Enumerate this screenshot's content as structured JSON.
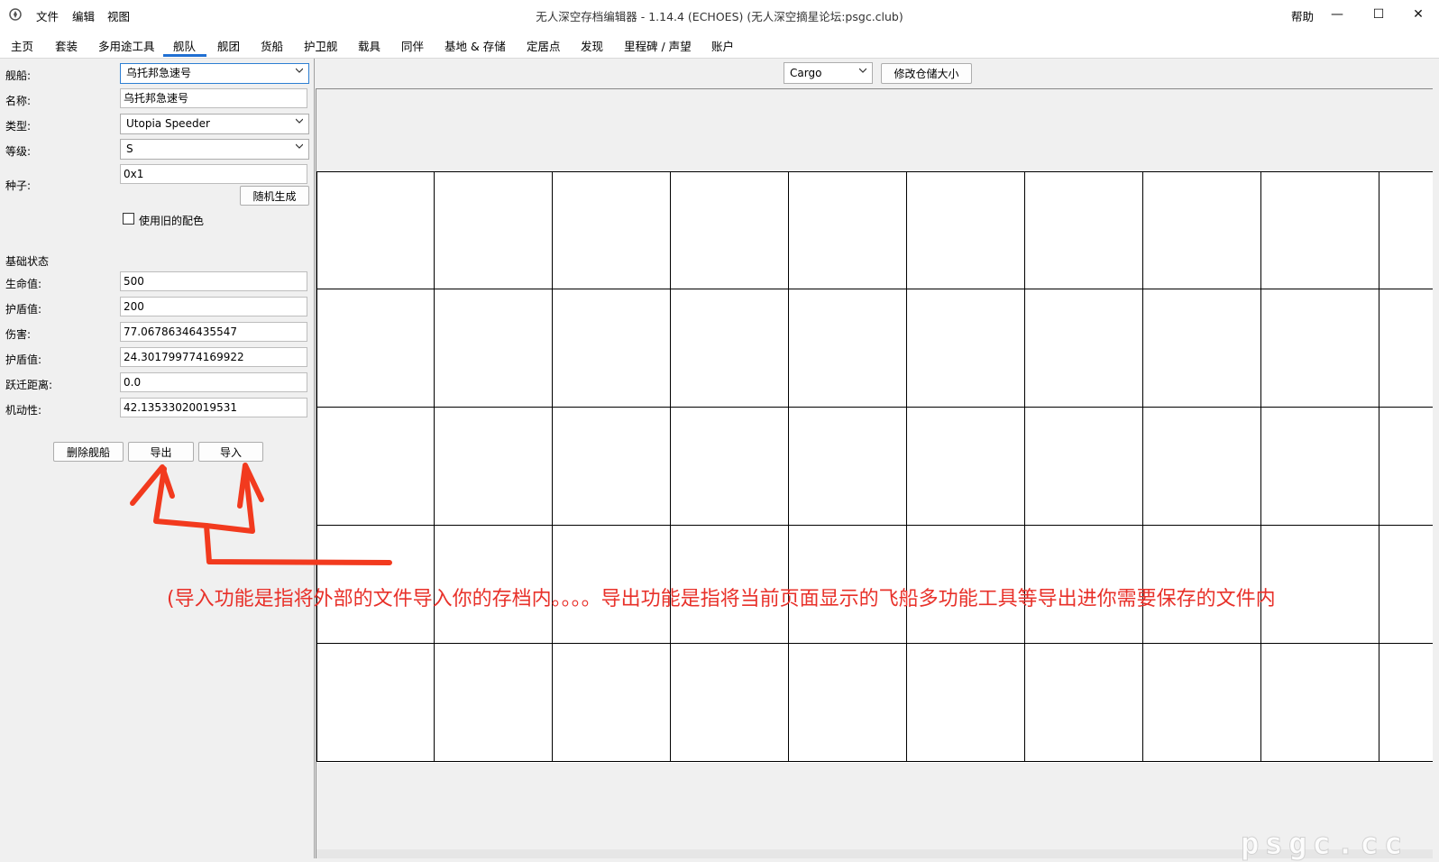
{
  "window": {
    "title": "无人深空存档编辑器 - 1.14.4 (ECHOES) (无人深空摘星论坛:psgc.club)",
    "menus": [
      "文件",
      "编辑",
      "视图"
    ],
    "help": "帮助",
    "controls": {
      "minimize": "—",
      "maximize": "☐",
      "close": "✕"
    }
  },
  "tabs": [
    "主页",
    "套装",
    "多用途工具",
    "舰队",
    "舰团",
    "货船",
    "护卫舰",
    "载具",
    "同伴",
    "基地 & 存储",
    "定居点",
    "发现",
    "里程碑 / 声望",
    "账户"
  ],
  "active_tab": "舰队",
  "ship_panel": {
    "ship_label": "舰船:",
    "ship_value": "乌托邦急速号",
    "name_label": "名称:",
    "name_value": "乌托邦急速号",
    "type_label": "类型:",
    "type_value": "Utopia Speeder",
    "class_label": "等级:",
    "class_value": "S",
    "seed_label": "种子:",
    "seed_value": "0x1",
    "random_button": "随机生成",
    "old_colors_label": "使用旧的配色",
    "old_colors_checked": false
  },
  "base_stats": {
    "heading": "基础状态",
    "health_label": "生命值:",
    "health_value": "500",
    "shield_label": "护盾值:",
    "shield_value": "200",
    "damage_label": "伤害:",
    "damage_value": "77.06786346435547",
    "shield2_label": "护盾值:",
    "shield2_value": "24.301799774169922",
    "warp_label": "跃迁距离:",
    "warp_value": "0.0",
    "maneuver_label": "机动性:",
    "maneuver_value": "42.13533020019531"
  },
  "actions": {
    "delete": "删除舰船",
    "export": "导出",
    "import": "导入"
  },
  "inventory": {
    "selected": "Cargo",
    "resize_button": "修改仓储大小",
    "rows": 5,
    "cols": 10
  },
  "annotation": {
    "text": "(导入功能是指将外部的文件导入你的存档内。。。。导出功能是指将当前页面显示的飞船多功能工具等导出进你需要保存的文件内",
    "color": "#e8312a"
  },
  "watermark": "psgc.cc",
  "colors": {
    "accent": "#1f6fd2",
    "annotation": "#e8312a"
  }
}
